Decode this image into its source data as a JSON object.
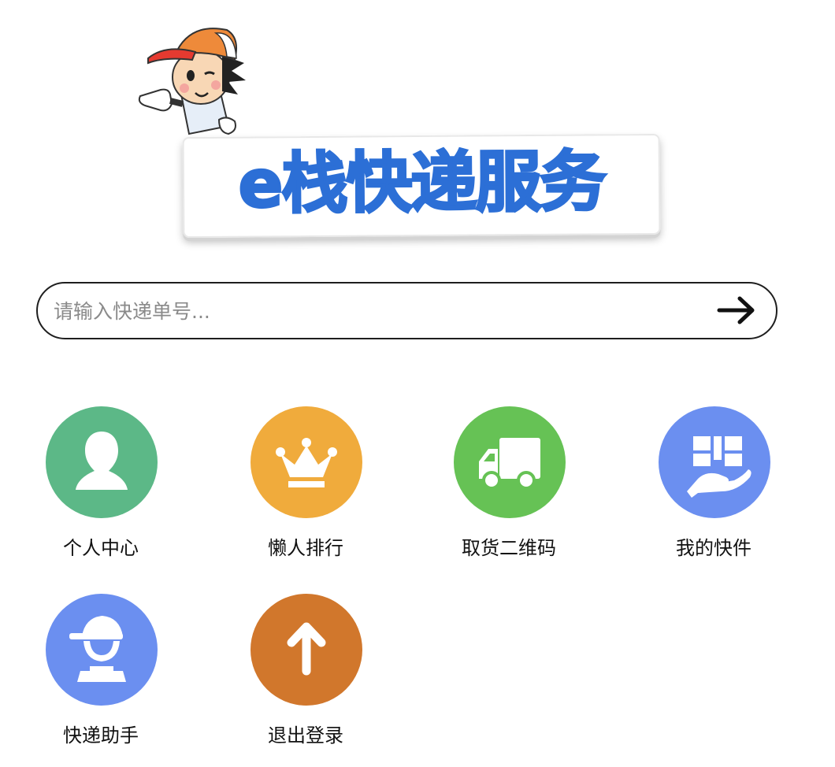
{
  "logo": {
    "title": "e栈快递服务"
  },
  "search": {
    "placeholder": "请输入快递单号..."
  },
  "actions": [
    {
      "label": "个人中心",
      "icon": "user-icon",
      "color": "#5cb887"
    },
    {
      "label": "懒人排行",
      "icon": "crown-icon",
      "color": "#f0ab3c"
    },
    {
      "label": "取货二维码",
      "icon": "truck-icon",
      "color": "#66c255"
    },
    {
      "label": "我的快件",
      "icon": "parcel-hand-icon",
      "color": "#6b8ff0"
    },
    {
      "label": "快递助手",
      "icon": "courier-icon",
      "color": "#6b8ff0"
    },
    {
      "label": "退出登录",
      "icon": "arrow-up-icon",
      "color": "#d1772c"
    }
  ]
}
